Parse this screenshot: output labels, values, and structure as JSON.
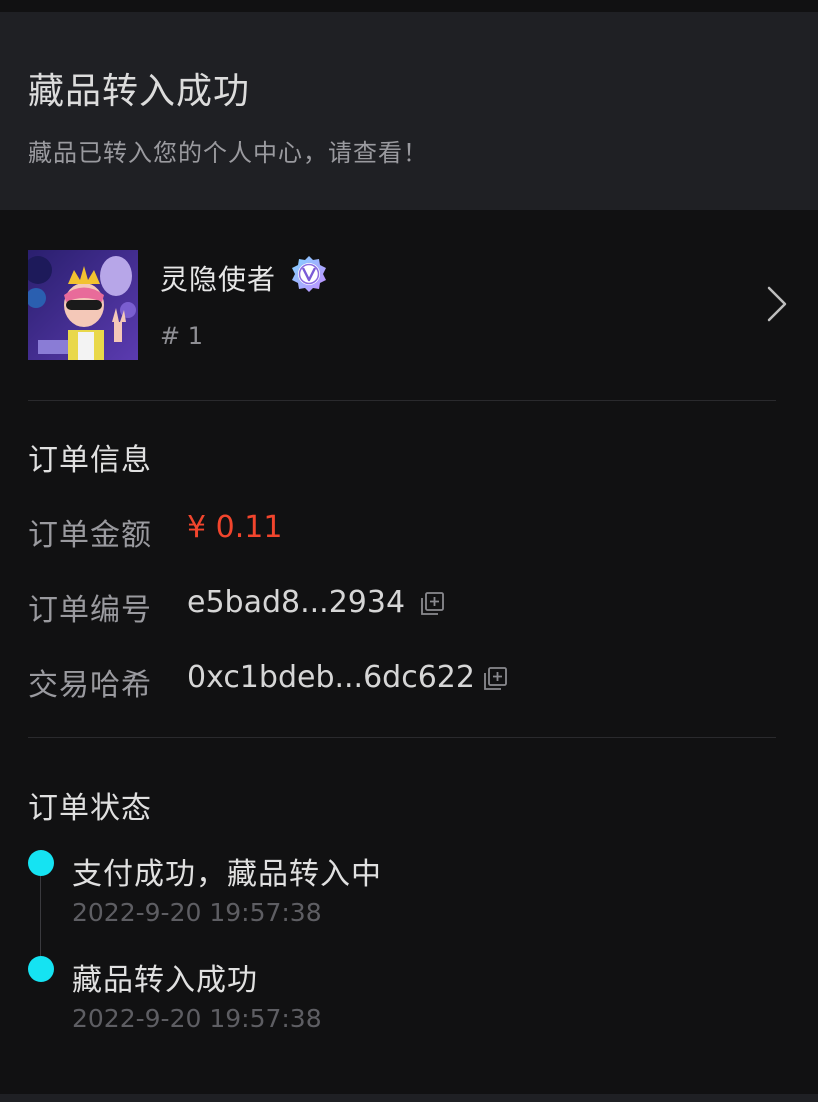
{
  "banner": {
    "title": "藏品转入成功",
    "subtitle": "藏品已转入您的个人中心，请查看！"
  },
  "item": {
    "name": "灵隐使者",
    "number": "# 1",
    "verified_icon": "verified-badge-icon",
    "thumbnail": "masked-king-avatar"
  },
  "order_info": {
    "title": "订单信息",
    "amount_label": "订单金额",
    "amount_value": "¥ 0.11",
    "order_no_label": "订单编号",
    "order_no_value": "e5bad8...2934",
    "hash_label": "交易哈希",
    "hash_value": "0xc1bdeb...6dc622"
  },
  "order_status": {
    "title": "订单状态",
    "steps": [
      {
        "title": "支付成功，藏品转入中",
        "time": "2022-9-20 19:57:38"
      },
      {
        "title": "藏品转入成功",
        "time": "2022-9-20 19:57:38"
      }
    ]
  },
  "colors": {
    "accent_dot": "#15e3f2",
    "amount": "#f2452d",
    "banner_bg": "#1f2024",
    "page_bg": "#111112"
  }
}
